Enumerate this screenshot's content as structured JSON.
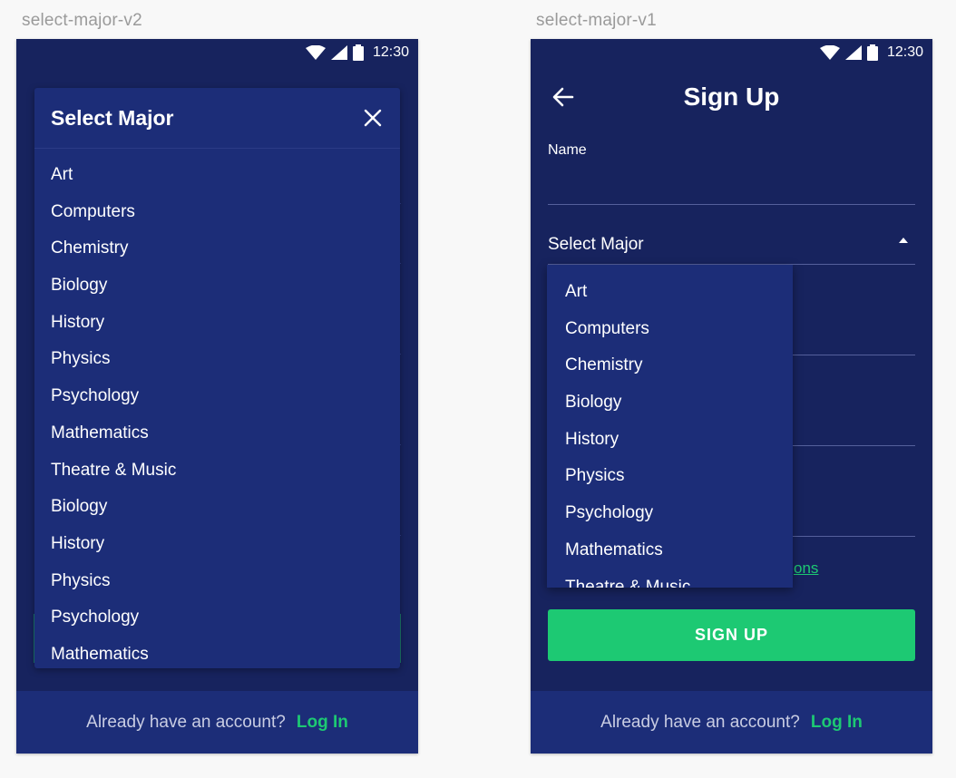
{
  "artboards": {
    "left_label": "select-major-v2",
    "right_label": "select-major-v1"
  },
  "status_bar": {
    "time": "12:30"
  },
  "v2": {
    "dialog_title": "Select Major",
    "majors": [
      "Art",
      "Computers",
      "Chemistry",
      "Biology",
      "History",
      "Physics",
      "Psychology",
      "Mathematics",
      "Theatre & Music",
      "Biology",
      "History",
      "Physics",
      "Psychology",
      "Mathematics"
    ]
  },
  "v1": {
    "title": "Sign Up",
    "name_label": "Name",
    "select_placeholder": "Select Major",
    "majors": [
      "Art",
      "Computers",
      "Chemistry",
      "Biology",
      "History",
      "Physics",
      "Psychology",
      "Mathematics",
      "Theatre & Music"
    ],
    "terms_fragment": "ons",
    "signup_button": "SIGN UP"
  },
  "footer": {
    "prompt": "Already have an account?",
    "login_link": "Log In"
  },
  "colors": {
    "background": "#17235e",
    "surface": "#1c2d78",
    "accent": "#1dc973"
  }
}
